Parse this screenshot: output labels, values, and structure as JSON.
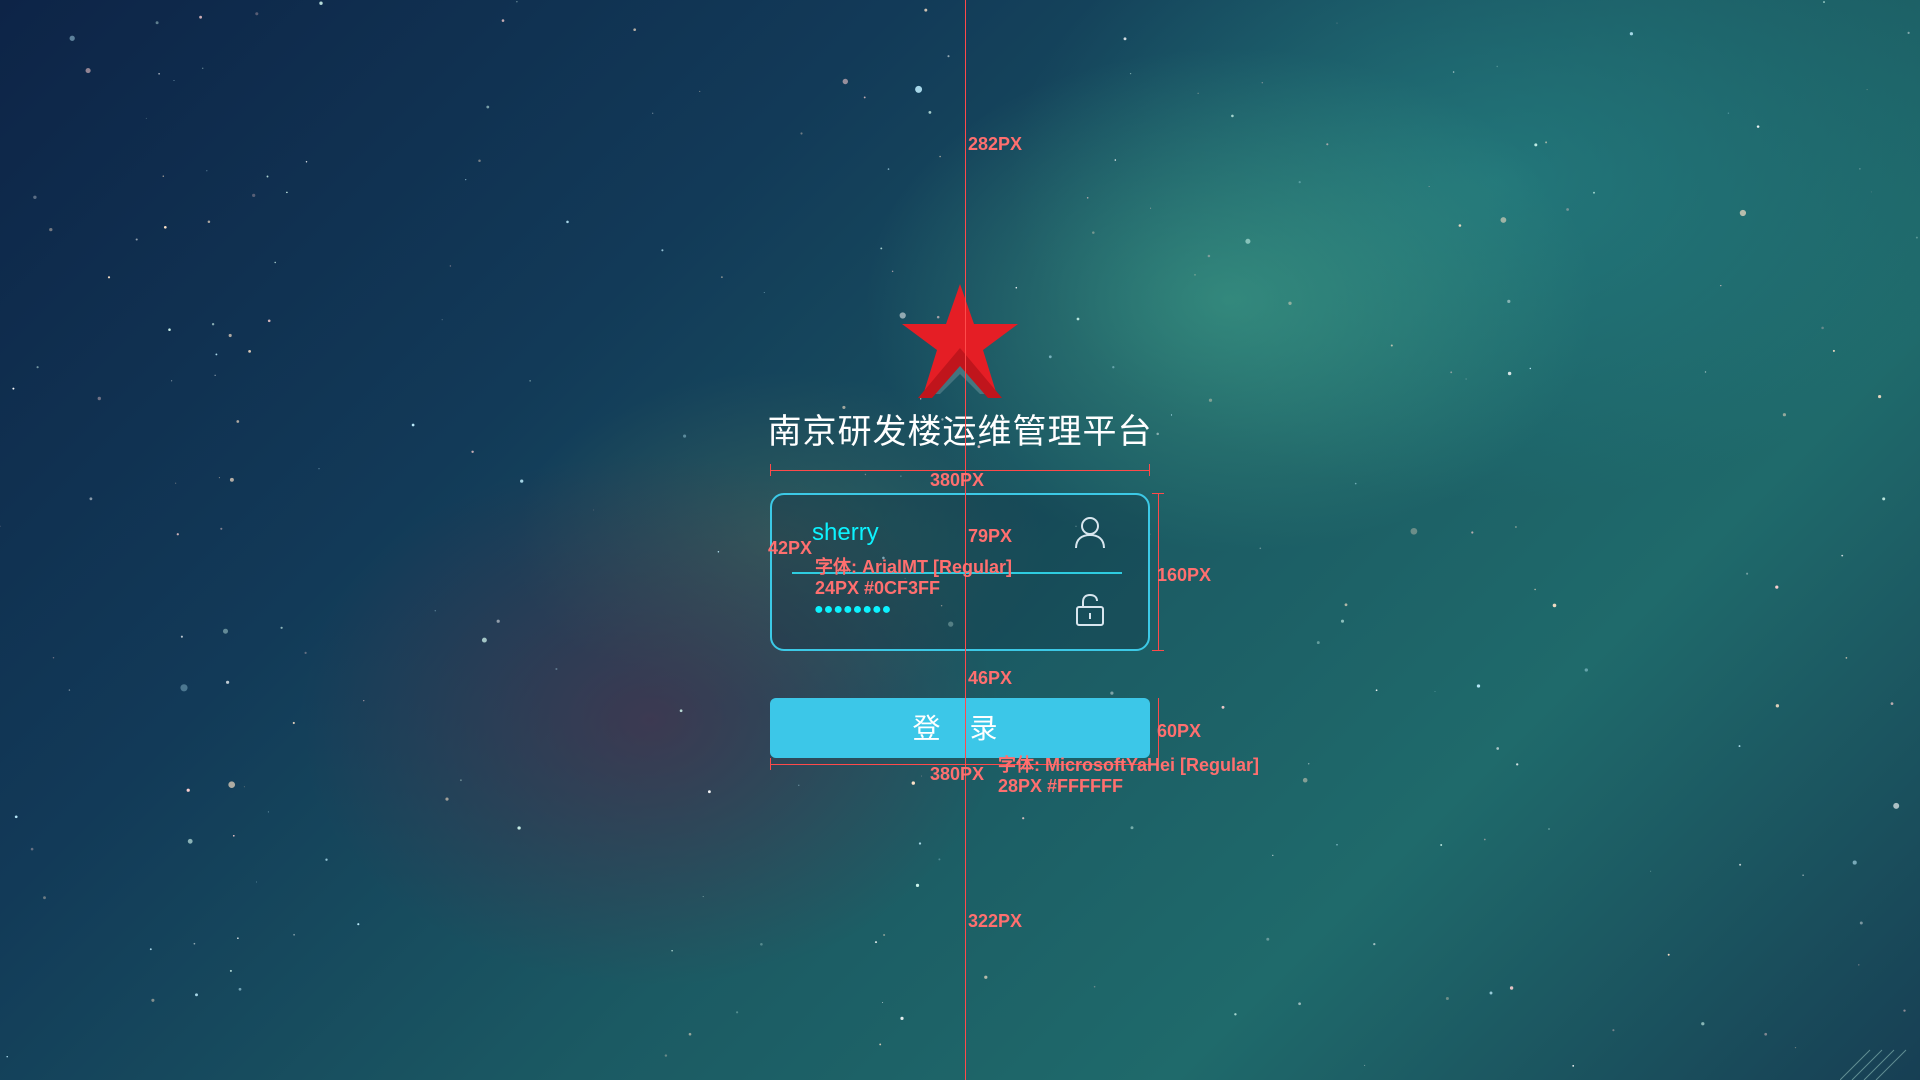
{
  "app": {
    "title": "南京研发楼运维管理平台"
  },
  "login_form": {
    "username_value": "sherry",
    "password_mask": "●●●●●●●●",
    "user_icon": "user-icon",
    "lock_icon": "unlock-icon"
  },
  "login_button": {
    "label": "登 录"
  },
  "annotations": {
    "top_spacing": "282PX",
    "form_width": "380PX",
    "field_offset": "42PX",
    "field_height": "79PX",
    "username_font": "字体: ArialMT [Regular]",
    "username_font_spec": "24PX #0CF3FF",
    "form_height": "160PX",
    "form_button_gap": "46PX",
    "button_height": "60PX",
    "button_width": "380PX",
    "button_font": "字体: MicrosoftYaHei [Regular]",
    "button_font_spec": "28PX #FFFFFF",
    "bottom_spacing": "322PX"
  },
  "colors": {
    "accent": "#0CF3FF",
    "button": "#3CC7E8",
    "logo": "#E51E25",
    "annotation": "#FF4A4A"
  }
}
